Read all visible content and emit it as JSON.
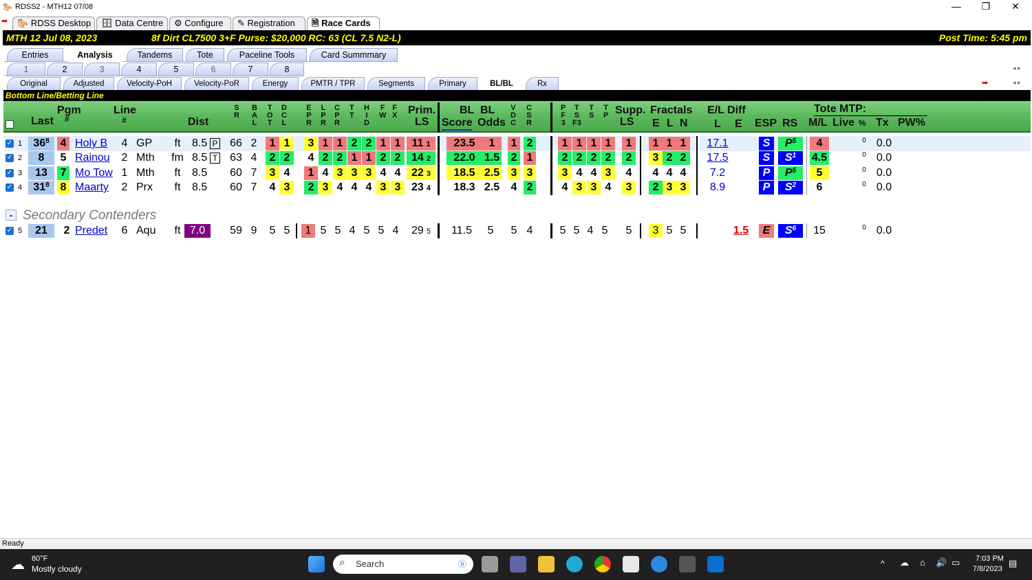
{
  "window": {
    "title": "RDSS2 - MTH12  07/08",
    "minimize": "—",
    "maximize": "❐",
    "close": "✕"
  },
  "main_tabs": [
    "RDSS Desktop",
    "Data Centre",
    "Configure",
    "Registration",
    "Race Cards"
  ],
  "race_bar": {
    "left": "MTH  12   Jul 08, 2023",
    "mid": "8f  Dirt   CL7500  3+F   Purse: $20,000   RC: 63  (CL 7.5 N2-L)",
    "right": "Post Time: 5:45 pm"
  },
  "view_tabs": [
    "Entries",
    "Analysis",
    "Tandems",
    "Tote",
    "Paceline Tools",
    "Card Summmary"
  ],
  "race_tabs": [
    "1",
    "2",
    "3",
    "4",
    "5",
    "6",
    "7",
    "8"
  ],
  "analysis_tabs": [
    "Original",
    "Adjusted",
    "Velocity-PoH",
    "Velocity-PoR",
    "Energy",
    "PMTR / TPR",
    "Segments",
    "Primary",
    "BL/BL",
    "Rx"
  ],
  "section_title": "Bottom Line/Betting Line",
  "headers": {
    "pgm": "Pgm",
    "pgm_num": "#",
    "last": "Last",
    "line": "Line",
    "line_num": "#",
    "dist": "Dist",
    "sr": "S\nR",
    "bal": "B\nA\nL",
    "tot": "T\nO\nT",
    "dcl": "D\nC\nL",
    "epr": "E\nP\nR",
    "lpr": "L\nP\nR",
    "cpr": "C\nP\nR",
    "tt": "T\nT",
    "hid": "H\nI\nD",
    "fw": "F\nW",
    "fx": "F\nX",
    "prim": "Prim.",
    "prim_ls": "LS",
    "bl1": "BL",
    "bl2": "BL",
    "score": "Score",
    "odds": "Odds",
    "vdc": "V\nD\nC",
    "csr": "C\nS\nR",
    "pf3": "P\nF\n3",
    "tsf3": "T\nS\nF3",
    "ts": "T\nS",
    "tp": "T\nP",
    "supp": "Supp.",
    "supp_ls": "LS",
    "fractals": "Fractals",
    "fe": "E",
    "fl": "L",
    "fn": "N",
    "eldiff": "E/L Diff",
    "el_l": "L",
    "el_e": "E",
    "esp": "ESP",
    "rs": "RS",
    "tote": "Tote MTP:",
    "ml": "M/L",
    "live": "Live",
    "pct": "%",
    "tx": "Tx",
    "pw": "PW%"
  },
  "rows": [
    {
      "n": "1",
      "last": "36",
      "last_sup": "8",
      "pgm": "4",
      "name": "Holy B",
      "line": "4",
      "trk": "GP",
      "surf": "ft",
      "dist": "8.5",
      "dbox": "P",
      "sr": "66",
      "bal": "2",
      "tot": "1",
      "dcl": "1",
      "epr": "3",
      "lpr": "1",
      "cpr": "1",
      "tt": "2",
      "hid": "2",
      "fw": "1",
      "fx": "1",
      "prim": "11",
      "prim_s": "1",
      "score": "23.5",
      "odds": "1",
      "vdc": "1",
      "csr": "2",
      "pf3": "1",
      "tsf3": "1",
      "ts": "1",
      "tp": "1",
      "supp": "1",
      "fe": "1",
      "fl": "1",
      "fn": "1",
      "el_l": "17.1",
      "esp": "S",
      "rs": "P",
      "rs_sup": "5",
      "ml": "4",
      "live": "0",
      "tx": "0.0"
    },
    {
      "n": "2",
      "last": "8",
      "last_sup": "",
      "pgm": "5",
      "name": "Rainou",
      "line": "2",
      "trk": "Mth",
      "surf": "fm",
      "dist": "8.5",
      "dbox": "T",
      "sr": "63",
      "bal": "4",
      "tot": "2",
      "dcl": "2",
      "epr": "4",
      "lpr": "2",
      "cpr": "2",
      "tt": "1",
      "hid": "1",
      "fw": "2",
      "fx": "2",
      "prim": "14",
      "prim_s": "2",
      "score": "22.0",
      "odds": "1.5",
      "vdc": "2",
      "csr": "1",
      "pf3": "2",
      "tsf3": "2",
      "ts": "2",
      "tp": "2",
      "supp": "2",
      "fe": "3",
      "fl": "2",
      "fn": "2",
      "el_l": "17.5",
      "esp": "S",
      "rs": "S",
      "rs_sup": "1",
      "ml": "4.5",
      "live": "0",
      "tx": "0.0"
    },
    {
      "n": "3",
      "last": "13",
      "last_sup": "",
      "pgm": "7",
      "name": "Mo Tow",
      "line": "1",
      "trk": "Mth",
      "surf": "ft",
      "dist": "8.5",
      "dbox": "",
      "sr": "60",
      "bal": "7",
      "tot": "3",
      "dcl": "4",
      "epr": "1",
      "lpr": "4",
      "cpr": "3",
      "tt": "3",
      "hid": "3",
      "fw": "4",
      "fx": "4",
      "prim": "22",
      "prim_s": "3",
      "score": "18.5",
      "odds": "2.5",
      "vdc": "3",
      "csr": "3",
      "pf3": "3",
      "tsf3": "4",
      "ts": "4",
      "tp": "3",
      "supp": "4",
      "fe": "4",
      "fl": "4",
      "fn": "4",
      "el_l": "7.2",
      "esp": "P",
      "rs": "P",
      "rs_sup": "5",
      "ml": "5",
      "live": "0",
      "tx": "0.0"
    },
    {
      "n": "4",
      "last": "31",
      "last_sup": "8",
      "pgm": "8",
      "name": "Maarty",
      "line": "2",
      "trk": "Prx",
      "surf": "ft",
      "dist": "8.5",
      "dbox": "",
      "sr": "60",
      "bal": "7",
      "tot": "4",
      "dcl": "3",
      "epr": "2",
      "lpr": "3",
      "cpr": "4",
      "tt": "4",
      "hid": "4",
      "fw": "3",
      "fx": "3",
      "prim": "23",
      "prim_s": "4",
      "score": "18.3",
      "odds": "2.5",
      "vdc": "4",
      "csr": "2",
      "pf3": "4",
      "tsf3": "3",
      "ts": "3",
      "tp": "4",
      "supp": "3",
      "fe": "2",
      "fl": "3",
      "fn": "3",
      "el_l": "8.9",
      "esp": "P",
      "rs": "S",
      "rs_sup": "2",
      "ml": "6",
      "live": "0",
      "tx": "0.0"
    }
  ],
  "secondary_title": "Secondary Contenders",
  "secondary_toggle": "-",
  "secondary": {
    "n": "5",
    "last": "21",
    "pgm": "2",
    "name": "Predet",
    "line": "6",
    "trk": "Aqu",
    "surf": "ft",
    "dist": "7.0",
    "sr": "59",
    "bal": "9",
    "tot": "5",
    "dcl": "5",
    "epr": "1",
    "lpr": "5",
    "cpr": "5",
    "tt": "4",
    "hid": "5",
    "fw": "5",
    "fx": "4",
    "prim": "29",
    "prim_s": "5",
    "score": "11.5",
    "odds": "5",
    "vdc": "5",
    "csr": "4",
    "pf3": "5",
    "tsf3": "5",
    "ts": "4",
    "tp": "5",
    "supp": "5",
    "fe": "3",
    "fl": "5",
    "fn": "5",
    "el_e": "1.5",
    "esp": "E",
    "rs": "S",
    "rs_sup": "6",
    "ml": "15",
    "live": "0",
    "tx": "0.0"
  },
  "status": "Ready",
  "taskbar": {
    "temp": "80°F",
    "weather": "Mostly cloudy",
    "search": "Search",
    "time": "7:03 PM",
    "date": "7/8/2023"
  }
}
